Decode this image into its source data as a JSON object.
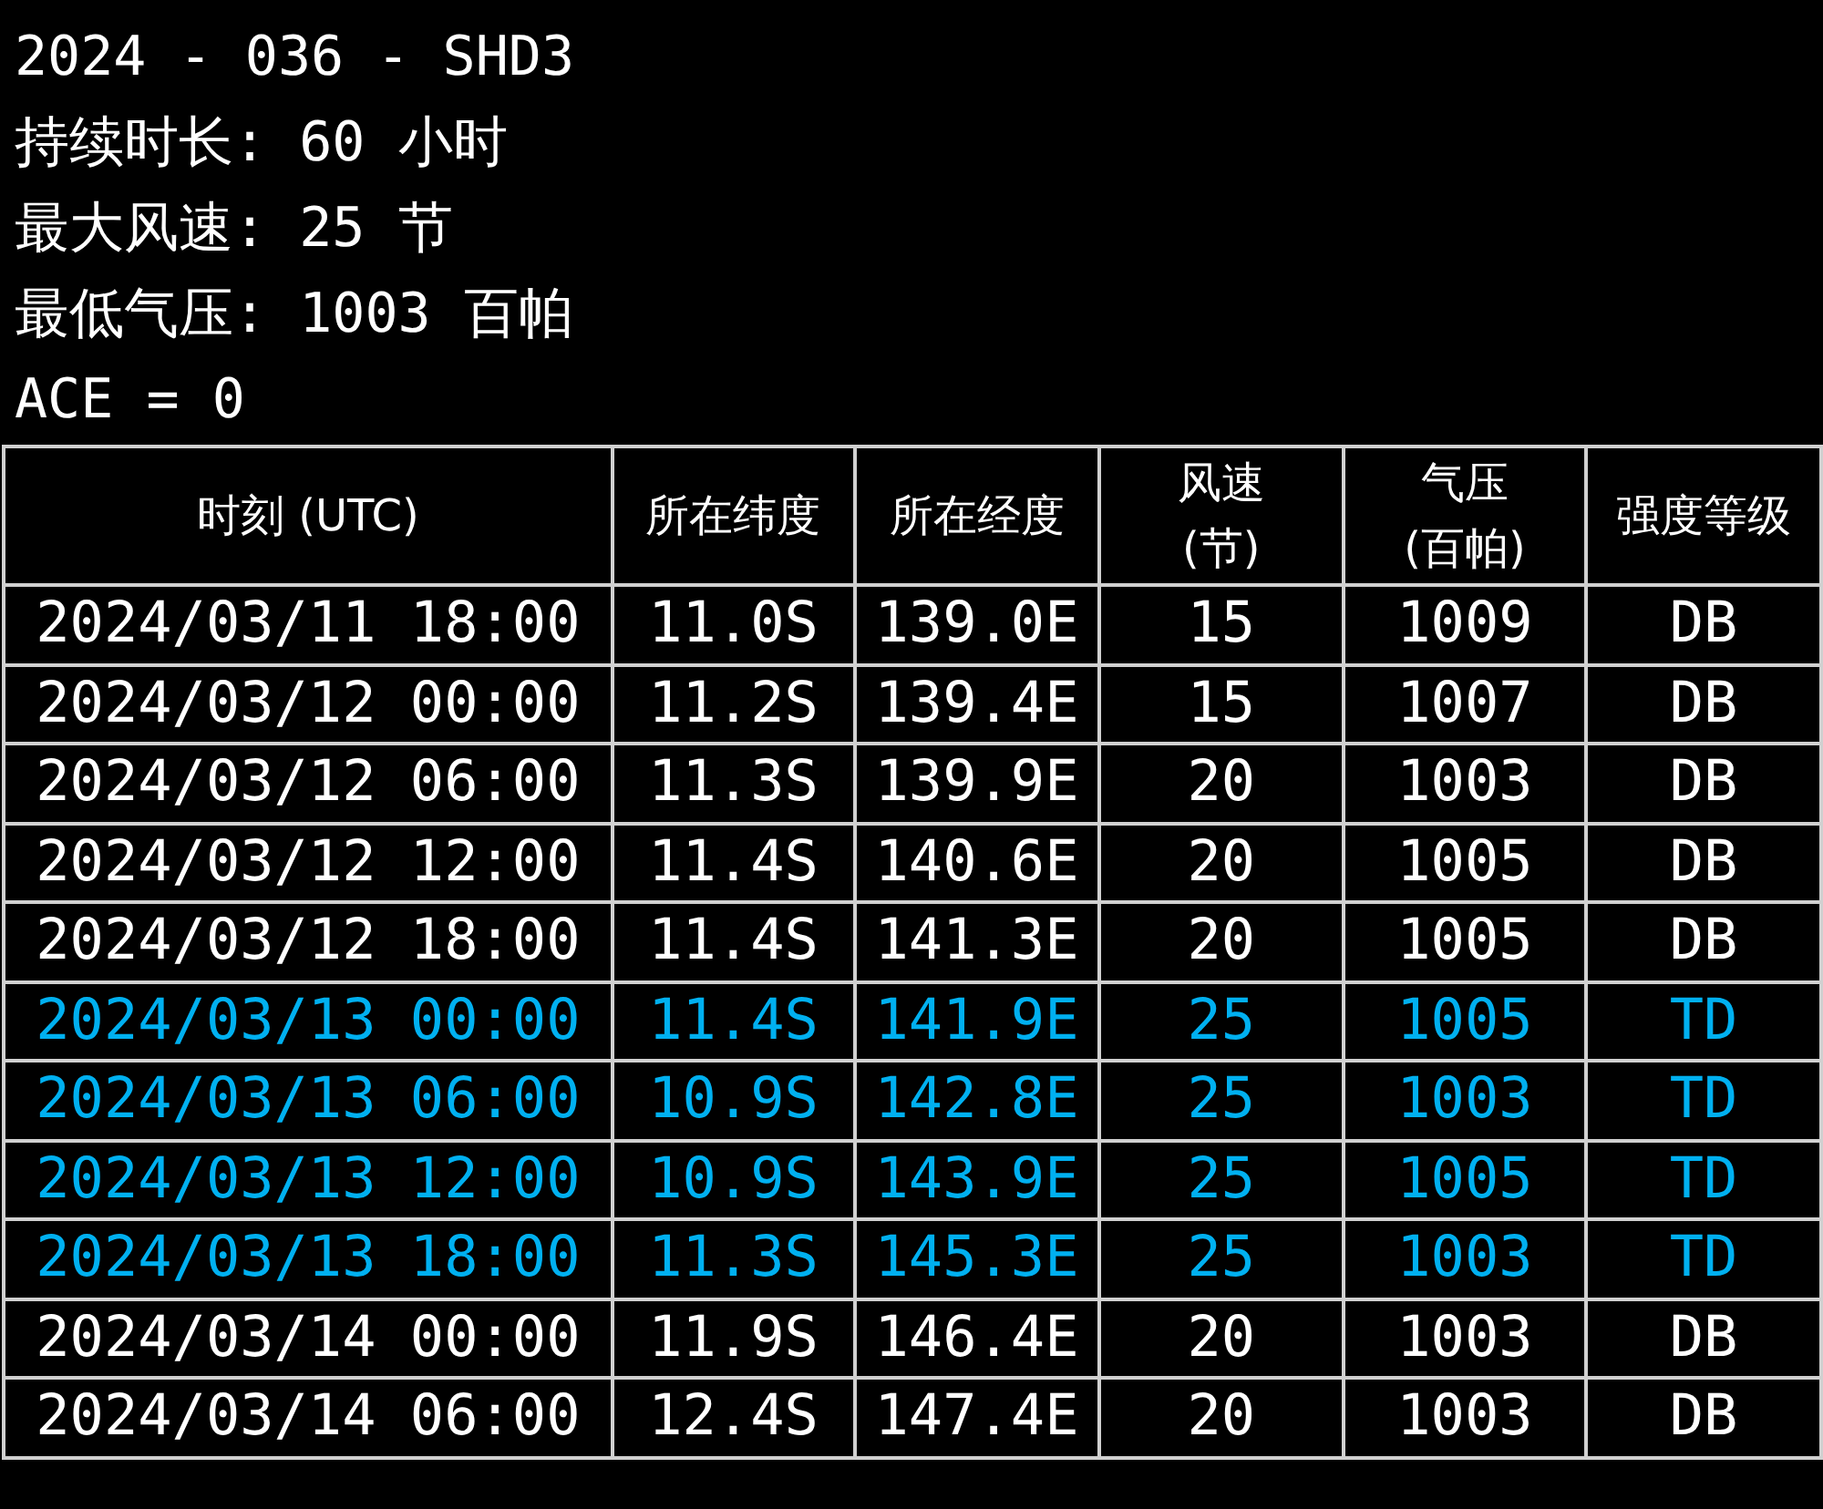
{
  "summary": [
    "2024 - 036 - SHD3",
    "持续时长: 60 小时",
    "最大风速: 25 节",
    "最低气压: 1003 百帕",
    "ACE = 0"
  ],
  "table": {
    "columns": [
      "时刻 (UTC)",
      "所在纬度",
      "所在经度",
      "风速\n(节)",
      "气压\n(百帕)",
      "强度等级"
    ],
    "rows": [
      {
        "color": "#ffffff",
        "cells": [
          "2024/03/11 18:00",
          "11.0S",
          "139.0E",
          "15",
          "1009",
          "DB"
        ]
      },
      {
        "color": "#ffffff",
        "cells": [
          "2024/03/12 00:00",
          "11.2S",
          "139.4E",
          "15",
          "1007",
          "DB"
        ]
      },
      {
        "color": "#ffffff",
        "cells": [
          "2024/03/12 06:00",
          "11.3S",
          "139.9E",
          "20",
          "1003",
          "DB"
        ]
      },
      {
        "color": "#ffffff",
        "cells": [
          "2024/03/12 12:00",
          "11.4S",
          "140.6E",
          "20",
          "1005",
          "DB"
        ]
      },
      {
        "color": "#ffffff",
        "cells": [
          "2024/03/12 18:00",
          "11.4S",
          "141.3E",
          "20",
          "1005",
          "DB"
        ]
      },
      {
        "color": "#00b0f0",
        "cells": [
          "2024/03/13 00:00",
          "11.4S",
          "141.9E",
          "25",
          "1005",
          "TD"
        ]
      },
      {
        "color": "#00b0f0",
        "cells": [
          "2024/03/13 06:00",
          "10.9S",
          "142.8E",
          "25",
          "1003",
          "TD"
        ]
      },
      {
        "color": "#00b0f0",
        "cells": [
          "2024/03/13 12:00",
          "10.9S",
          "143.9E",
          "25",
          "1005",
          "TD"
        ]
      },
      {
        "color": "#00b0f0",
        "cells": [
          "2024/03/13 18:00",
          "11.3S",
          "145.3E",
          "25",
          "1003",
          "TD"
        ]
      },
      {
        "color": "#ffffff",
        "cells": [
          "2024/03/14 00:00",
          "11.9S",
          "146.4E",
          "20",
          "1003",
          "DB"
        ]
      },
      {
        "color": "#ffffff",
        "cells": [
          "2024/03/14 06:00",
          "12.4S",
          "147.4E",
          "20",
          "1003",
          "DB"
        ]
      }
    ]
  }
}
